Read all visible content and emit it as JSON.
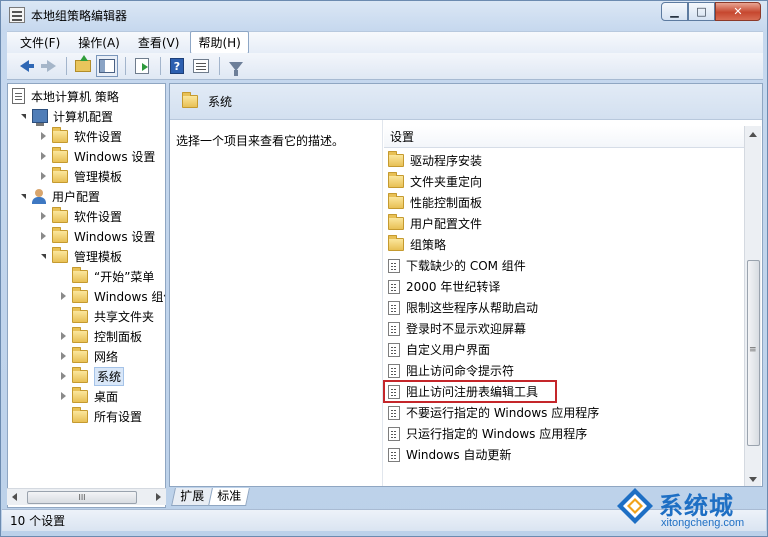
{
  "window": {
    "title": "本地组策略编辑器",
    "caption": {
      "minimize": "▁",
      "maximize": "□",
      "close": "✕"
    }
  },
  "menu": [
    "文件(F)",
    "操作(A)",
    "查看(V)",
    "帮助(H)"
  ],
  "toolbar_icons": [
    "back-icon",
    "forward-icon",
    "up-folder-icon",
    "show-hide-tree-icon",
    "export-list-icon",
    "help-icon",
    "properties-icon",
    "filter-icon"
  ],
  "tree": {
    "root": "本地计算机 策略",
    "computer_config": "计算机配置",
    "cc_software": "软件设置",
    "cc_windows": "Windows 设置",
    "cc_admin": "管理模板",
    "user_config": "用户配置",
    "uc_software": "软件设置",
    "uc_windows": "Windows 设置",
    "uc_admin": "管理模板",
    "start_menu": "“开始”菜单",
    "windows_components": "Windows 组件",
    "shared_folders": "共享文件夹",
    "control_panel": "控制面板",
    "network": "网络",
    "system": "系统",
    "desktop": "桌面",
    "all_settings": "所有设置"
  },
  "hscroll_grip": "III",
  "header": {
    "title": "系统"
  },
  "description": "选择一个项目来查看它的描述。",
  "list": {
    "column": "设置",
    "items": [
      "驱动程序安装",
      "文件夹重定向",
      "性能控制面板",
      "用户配置文件",
      "组策略",
      "下载缺少的 COM 组件",
      "2000 年世纪转译",
      "限制这些程序从帮助启动",
      "登录时不显示欢迎屏幕",
      "自定义用户界面",
      "阻止访问命令提示符",
      "阻止访问注册表编辑工具",
      "不要运行指定的 Windows 应用程序",
      "只运行指定的 Windows 应用程序",
      "Windows 自动更新"
    ]
  },
  "tabs": [
    "扩展",
    "标准"
  ],
  "status": "10 个设置",
  "watermark": {
    "brand": "系统城",
    "url": "xitongcheng.com"
  },
  "colors": {
    "highlight_box": "#c4262a",
    "brand_blue": "#1e6fc4",
    "header_band": "#d3e0f0"
  }
}
